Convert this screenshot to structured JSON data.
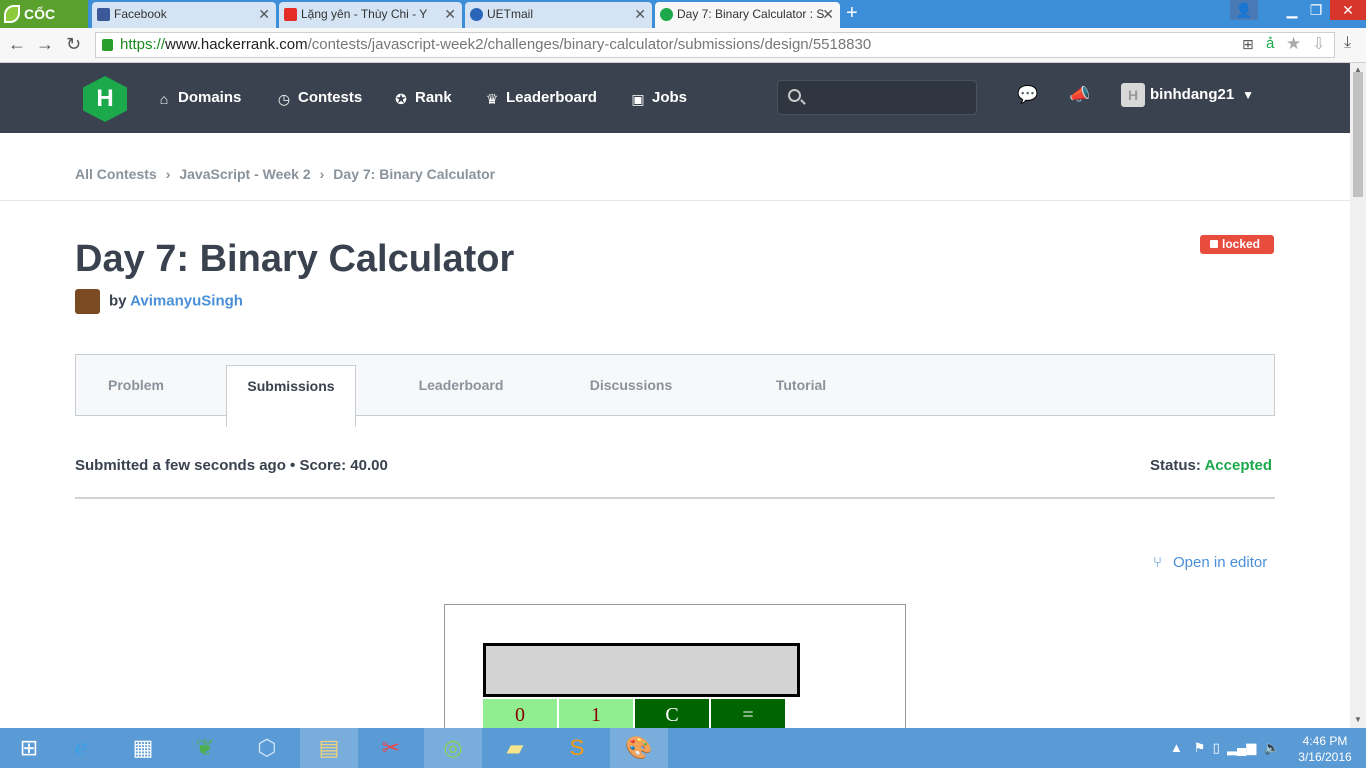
{
  "browser": {
    "brand": "CỐC CỐC",
    "tabs": [
      {
        "label": "Facebook"
      },
      {
        "label": "Lặng yên - Thùy Chi - Y"
      },
      {
        "label": "UETmail"
      },
      {
        "label": "Day 7: Binary Calculator : S"
      }
    ],
    "url": {
      "scheme": "https://",
      "host": "www.hackerrank.com",
      "path": "/contests/javascript-week2/challenges/binary-calculator/submissions/design/5518830"
    }
  },
  "header": {
    "logo": "H",
    "nav": [
      "Domains",
      "Contests",
      "Rank",
      "Leaderboard",
      "Jobs"
    ],
    "user": "binhdang21"
  },
  "breadcrumb": [
    "All Contests",
    "JavaScript - Week 2",
    "Day 7: Binary Calculator"
  ],
  "challenge": {
    "title": "Day 7: Binary Calculator",
    "by": "by",
    "author": "AvimanyuSingh",
    "badge": "locked"
  },
  "tabs": [
    "Problem",
    "Submissions",
    "Leaderboard",
    "Discussions",
    "Tutorial"
  ],
  "submission": {
    "info": "Submitted a few seconds ago • Score: 40.00",
    "status_label": "Status:",
    "status_value": "Accepted",
    "open_editor": "Open in editor"
  },
  "calculator": {
    "buttons": [
      "0",
      "1",
      "C",
      "="
    ]
  },
  "taskbar": {
    "time": "4:46 PM",
    "date": "3/16/2016"
  },
  "colors": {
    "header_bg": "#39424e",
    "accent_green": "#1ba94c",
    "link_blue": "#4a90d9",
    "locked_red": "#e84c3d"
  }
}
